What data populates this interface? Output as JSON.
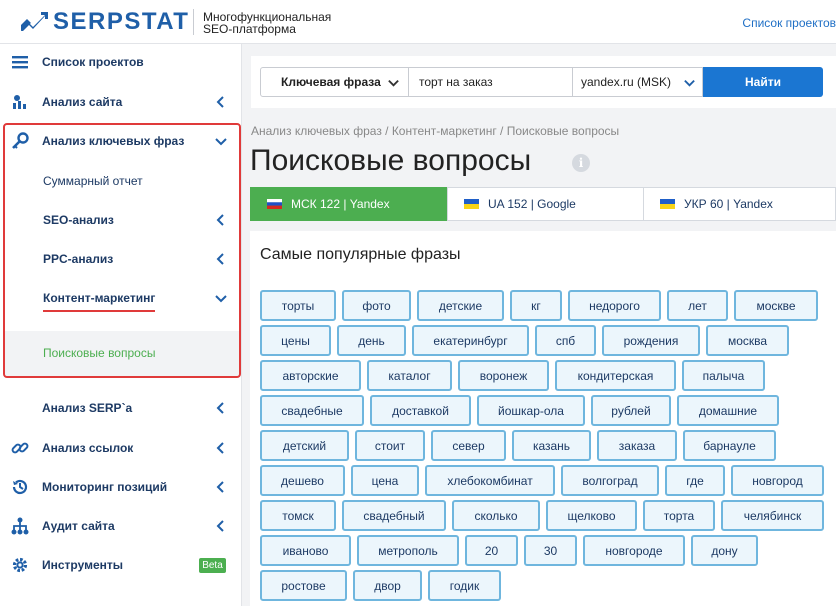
{
  "header": {
    "logo_text": "SERPSTAT",
    "tagline_line1": "Многофункциональная",
    "tagline_line2": "SEO-платформа",
    "projects_link": "Список проектов"
  },
  "sidebar": {
    "items": [
      {
        "label": "Список проектов",
        "icon": "menu-icon"
      },
      {
        "label": "Анализ сайта",
        "icon": "site-analysis-icon"
      },
      {
        "label": "Анализ ключевых фраз",
        "icon": "key-icon"
      },
      {
        "label": "Суммарный отчет"
      },
      {
        "label": "SEO-анализ"
      },
      {
        "label": "PPC-анализ"
      },
      {
        "label": "Контент-маркетинг"
      },
      {
        "label": "Поисковые вопросы"
      },
      {
        "label": "Анализ SERP`a"
      },
      {
        "label": "Анализ ссылок",
        "icon": "link-icon"
      },
      {
        "label": "Мониторинг позиций",
        "icon": "history-icon"
      },
      {
        "label": "Аудит сайта",
        "icon": "sitemap-icon"
      },
      {
        "label": "Инструменты",
        "icon": "gear-icon"
      }
    ],
    "beta_badge": "Beta"
  },
  "search": {
    "type_label": "Ключевая фраза",
    "query_value": "торт на заказ",
    "database": "yandex.ru (MSK)",
    "find_button": "Найти"
  },
  "breadcrumb": "Анализ ключевых фраз / Контент-маркетинг / Поисковые вопросы",
  "page_title": "Поисковые вопросы",
  "tabs": [
    {
      "label": "МСК 122 | Yandex",
      "flag": "ru",
      "active": true
    },
    {
      "label": "UA 152 | Google",
      "flag": "ua"
    },
    {
      "label": "УКР 60 | Yandex",
      "flag": "ua"
    }
  ],
  "panel": {
    "title": "Самые популярные фразы",
    "tags": [
      [
        "торты",
        "фото",
        "детские",
        "кг",
        "недорого",
        "лет",
        "москве"
      ],
      [
        "цены",
        "день",
        "екатеринбург",
        "спб",
        "рождения",
        "москва"
      ],
      [
        "авторские",
        "каталог",
        "воронеж",
        "кондитерская",
        "палыча"
      ],
      [
        "свадебные",
        "доставкой",
        "йошкар-ола",
        "рублей",
        "домашние"
      ],
      [
        "детский",
        "стоит",
        "север",
        "казань",
        "заказа",
        "барнауле"
      ],
      [
        "дешево",
        "цена",
        "хлебокомбинат",
        "волгоград",
        "где",
        "новгород"
      ],
      [
        "томск",
        "свадебный",
        "сколько",
        "щелково",
        "торта",
        "челябинск"
      ],
      [
        "иваново",
        "метрополь",
        "20",
        "30",
        "новгороде",
        "дону"
      ],
      [
        "ростове",
        "двор",
        "годик"
      ]
    ]
  },
  "colors": {
    "brand": "#1f5fa8",
    "button": "#1b76d2",
    "active_tab": "#4cae50",
    "highlight": "#e03a3a",
    "tag_border": "#6fb6de"
  }
}
